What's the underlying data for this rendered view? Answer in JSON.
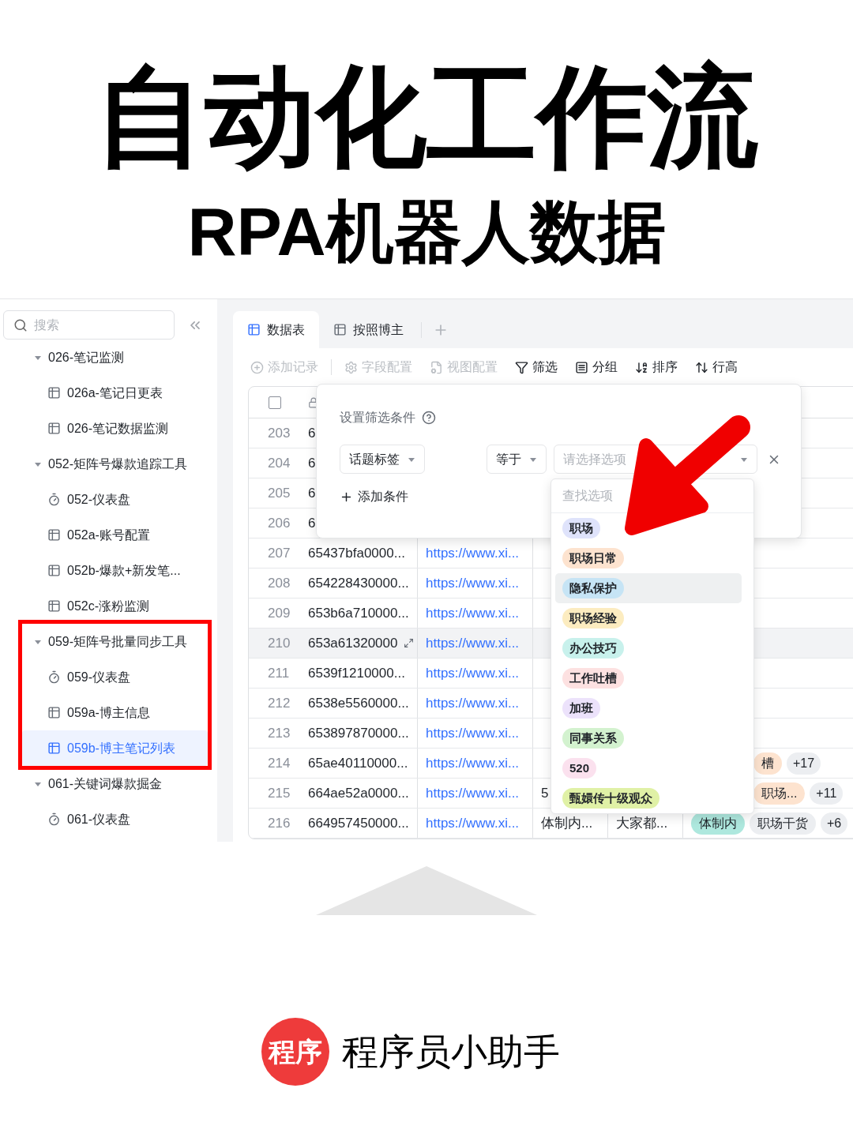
{
  "header": {
    "title": "自动化工作流",
    "subtitle": "RPA机器人数据"
  },
  "sidebar": {
    "search": {
      "placeholder": "搜索"
    },
    "items": [
      {
        "label": "026-笔记监测",
        "expanded": true,
        "annotated": false,
        "children": [
          {
            "label": "026a-笔记日更表",
            "kind": "table",
            "selected": false
          },
          {
            "label": "026-笔记数据监测",
            "kind": "table",
            "selected": false
          }
        ]
      },
      {
        "label": "052-矩阵号爆款追踪工具",
        "expanded": true,
        "annotated": false,
        "children": [
          {
            "label": "052-仪表盘",
            "kind": "dashboard",
            "selected": false
          },
          {
            "label": "052a-账号配置",
            "kind": "table",
            "selected": false
          },
          {
            "label": "052b-爆款+新发笔...",
            "kind": "table",
            "selected": false
          },
          {
            "label": "052c-涨粉监测",
            "kind": "table",
            "selected": false
          }
        ]
      },
      {
        "label": "059-矩阵号批量同步工具",
        "expanded": true,
        "annotated": true,
        "children": [
          {
            "label": "059-仪表盘",
            "kind": "dashboard",
            "selected": false
          },
          {
            "label": "059a-博主信息",
            "kind": "table",
            "selected": false
          },
          {
            "label": "059b-博主笔记列表",
            "kind": "table",
            "selected": true
          }
        ]
      },
      {
        "label": "061-关键词爆款掘金",
        "expanded": true,
        "annotated": false,
        "children": [
          {
            "label": "061-仪表盘",
            "kind": "dashboard",
            "selected": false
          }
        ]
      }
    ]
  },
  "tabs": [
    {
      "label": "数据表",
      "selected": true
    },
    {
      "label": "按照博主",
      "selected": false
    }
  ],
  "toolbar": [
    {
      "label": "添加记录",
      "kind": "add",
      "disabled": true
    },
    {
      "label": "字段配置",
      "kind": "fields",
      "disabled": true
    },
    {
      "label": "视图配置",
      "kind": "view",
      "disabled": true
    },
    {
      "label": "筛选",
      "kind": "filter",
      "disabled": false
    },
    {
      "label": "分组",
      "kind": "group",
      "disabled": false
    },
    {
      "label": "排序",
      "kind": "sort",
      "disabled": false
    },
    {
      "label": "行高",
      "kind": "height",
      "disabled": false
    }
  ],
  "table": {
    "select_all": {
      "checked": false
    },
    "rows": [
      {
        "index": "203",
        "id": "6",
        "hovered": false
      },
      {
        "index": "204",
        "id": "6",
        "hovered": false
      },
      {
        "index": "205",
        "id": "6",
        "hovered": false
      },
      {
        "index": "206",
        "id": "6",
        "hovered": false
      },
      {
        "index": "207",
        "id": "65437bfa0000...",
        "url": "https://www.xi...",
        "hovered": false
      },
      {
        "index": "208",
        "id": "654228430000...",
        "url": "https://www.xi...",
        "hovered": false
      },
      {
        "index": "209",
        "id": "653b6a710000...",
        "url": "https://www.xi...",
        "hovered": false
      },
      {
        "index": "210",
        "id": "653a61320000",
        "url": "https://www.xi...",
        "hovered": true
      },
      {
        "index": "211",
        "id": "6539f1210000...",
        "url": "https://www.xi...",
        "hovered": false
      },
      {
        "index": "212",
        "id": "6538e5560000...",
        "url": "https://www.xi...",
        "hovered": false
      },
      {
        "index": "213",
        "id": "653897870000...",
        "url": "https://www.xi...",
        "hovered": false
      },
      {
        "index": "214",
        "id": "65ae40110000...",
        "url": "https://www.xi...",
        "hovered": false,
        "tags": [
          {
            "label": "槽",
            "kind": "tag",
            "color": "#fde3cf"
          },
          {
            "label": "+17",
            "kind": "count"
          }
        ]
      },
      {
        "index": "215",
        "id": "664ae52a0000...",
        "url": "https://www.xi...",
        "column_4": "5",
        "hovered": false,
        "tags": [
          {
            "label": "职场...",
            "kind": "tag",
            "color": "#fde3cf"
          },
          {
            "label": "+11",
            "kind": "count"
          }
        ]
      },
      {
        "index": "216",
        "id": "664957450000...",
        "url": "https://www.xi...",
        "column_4": "体制内...",
        "column_5": "大家都...",
        "hovered": false,
        "tags": [
          {
            "label": "体制内",
            "kind": "tag",
            "color": "#aee8de"
          },
          {
            "label": "职场干货",
            "kind": "tag",
            "color": "#eceef1"
          },
          {
            "label": "+6",
            "kind": "count"
          }
        ]
      }
    ]
  },
  "filter": {
    "title": "设置筛选条件",
    "conditions": [
      {
        "field": "话题标签",
        "operator": "等于",
        "value_placeholder": "请选择选项"
      }
    ],
    "add_label": "添加条件"
  },
  "options_menu": {
    "search_placeholder": "查找选项",
    "options": [
      {
        "label": "职场",
        "color": "#dfe3fb",
        "highlighted": false
      },
      {
        "label": "职场日常",
        "color": "#fde3cf",
        "highlighted": false
      },
      {
        "label": "隐私保护",
        "color": "#c6e4f5",
        "highlighted": true
      },
      {
        "label": "职场经验",
        "color": "#fcecc0",
        "highlighted": false
      },
      {
        "label": "办公技巧",
        "color": "#c8f1ec",
        "highlighted": false
      },
      {
        "label": "工作吐槽",
        "color": "#fde1e1",
        "highlighted": false
      },
      {
        "label": "加班",
        "color": "#ece2fb",
        "highlighted": false
      },
      {
        "label": "同事关系",
        "color": "#d3f2cf",
        "highlighted": false
      },
      {
        "label": "520",
        "color": "#fbe1ee",
        "highlighted": false
      },
      {
        "label": "甄嬛传十级观众",
        "color": "#e0f1a6",
        "highlighted": false
      }
    ]
  },
  "footer": {
    "logo_text": "程序",
    "brand": "程序员小助手"
  }
}
